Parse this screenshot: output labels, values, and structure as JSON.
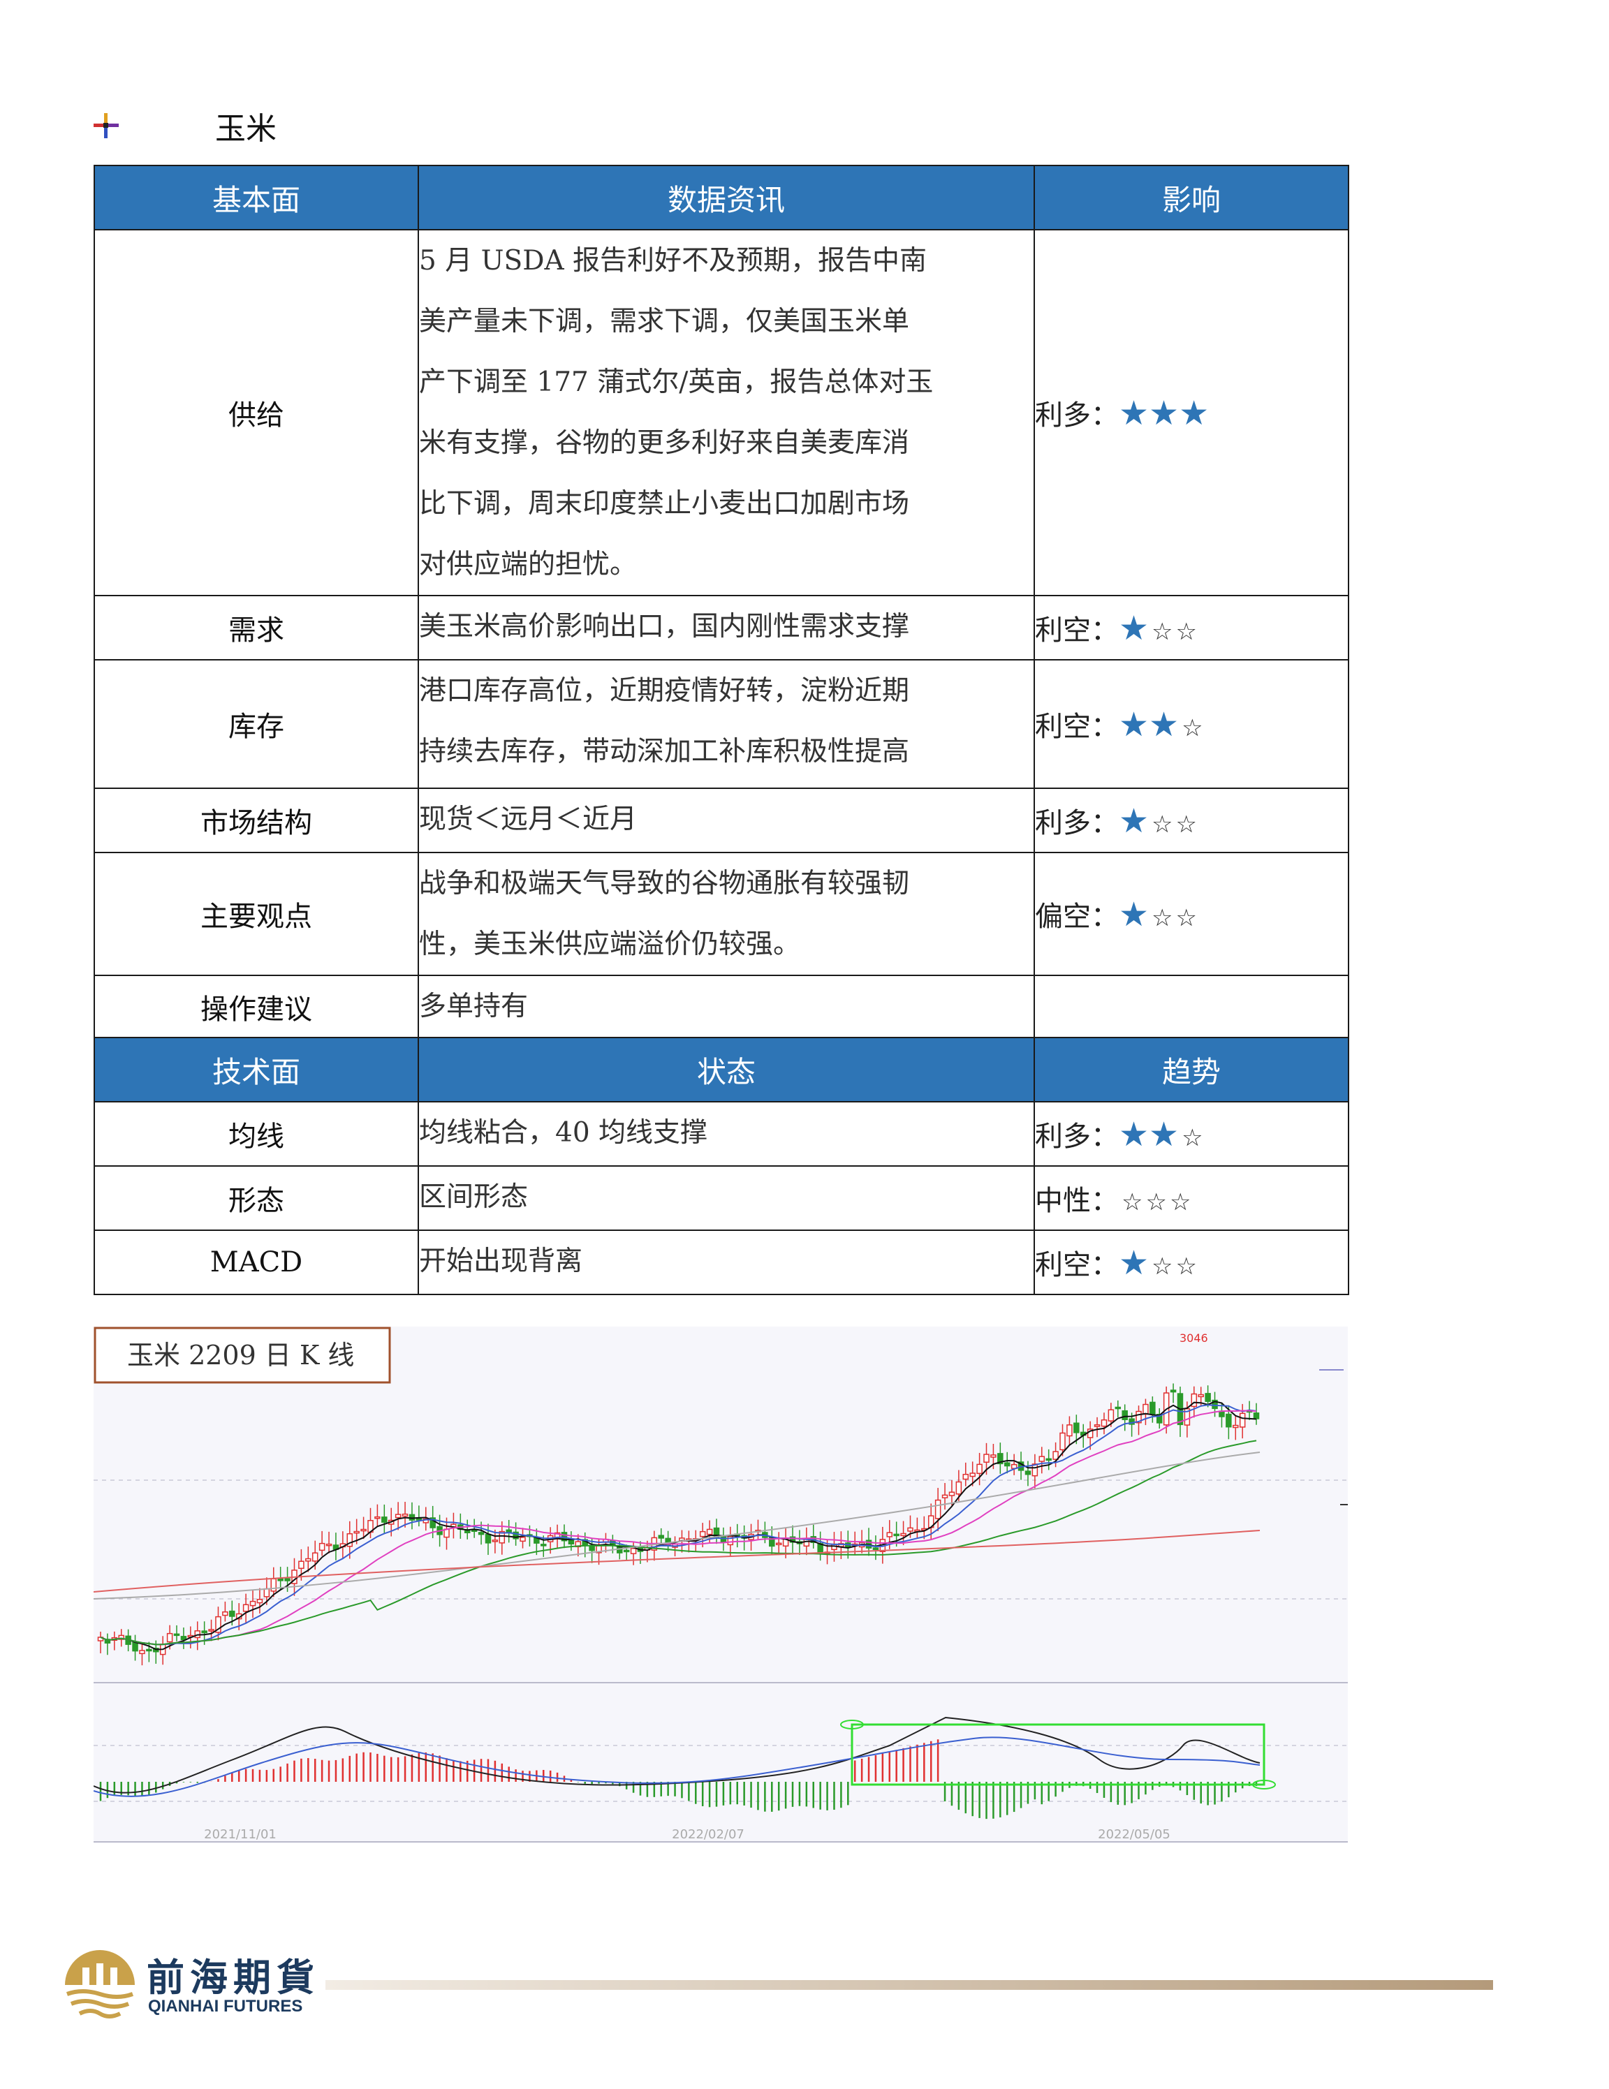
{
  "section": {
    "title": "玉米",
    "icon": "bullet-cross-icon"
  },
  "fundamentals_header": [
    "基本面",
    "数据资讯",
    "影响"
  ],
  "fundamentals": [
    {
      "label": "供给",
      "lines": [
        "5 月 USDA 报告利好不及预期，报告中南",
        "美产量未下调，需求下调，仅美国玉米单",
        "产下调至 177 蒲式尔/英亩，报告总体对玉",
        "米有支撑，谷物的更多利好来自美麦库消",
        "比下调，周末印度禁止小麦出口加剧市场",
        "对供应端的担忧。"
      ],
      "impact": "利多：",
      "stars_filled": 3,
      "stars_total": 3
    },
    {
      "label": "需求",
      "lines": [
        "美玉米高价影响出口，国内刚性需求支撑"
      ],
      "impact": "利空：",
      "stars_filled": 1,
      "stars_total": 3
    },
    {
      "label": "库存",
      "lines": [
        "港口库存高位，近期疫情好转，淀粉近期",
        "持续去库存，带动深加工补库积极性提高"
      ],
      "impact": "利空：",
      "stars_filled": 2,
      "stars_total": 3
    },
    {
      "label": "市场结构",
      "lines": [
        "现货＜远月＜近月"
      ],
      "impact": "利多：",
      "stars_filled": 1,
      "stars_total": 3
    },
    {
      "label": "主要观点",
      "lines": [
        "战争和极端天气导致的谷物通胀有较强韧",
        "性，美玉米供应端溢价仍较强。"
      ],
      "impact": "偏空：",
      "stars_filled": 1,
      "stars_total": 3
    },
    {
      "label": "操作建议",
      "lines": [
        "多单持有"
      ],
      "impact": "",
      "stars_filled": 0,
      "stars_total": 0
    }
  ],
  "technical_header": [
    "技术面",
    "状态",
    "趋势"
  ],
  "technical": [
    {
      "label": "均线",
      "lines": [
        "均线粘合，40 均线支撑"
      ],
      "impact": "利多：",
      "stars_filled": 2,
      "stars_total": 3
    },
    {
      "label": "形态",
      "lines": [
        "区间形态"
      ],
      "impact": "中性：",
      "stars_filled": 0,
      "stars_total": 3
    },
    {
      "label": "MACD",
      "lines": [
        "开始出现背离"
      ],
      "impact": "利空：",
      "stars_filled": 1,
      "stars_total": 3
    }
  ],
  "chart": {
    "title": "玉米 2209 日 K 线",
    "peak_label": "3046",
    "date_labels": [
      "2021/11/01",
      "2022/02/07",
      "2022/05/05"
    ],
    "colors": {
      "up": "#e03030",
      "down": "#2a9a2a",
      "ma5": "#111111",
      "ma10": "#3a5fd0",
      "ma20": "#e040c0",
      "ma40": "#2a9a2a",
      "ma60": "#aaaaaa",
      "ma120": "#e06060",
      "box": "#33dd33"
    }
  },
  "footer": {
    "brand_cn": "前海期貨",
    "brand_en": "QIANHAI FUTURES"
  }
}
